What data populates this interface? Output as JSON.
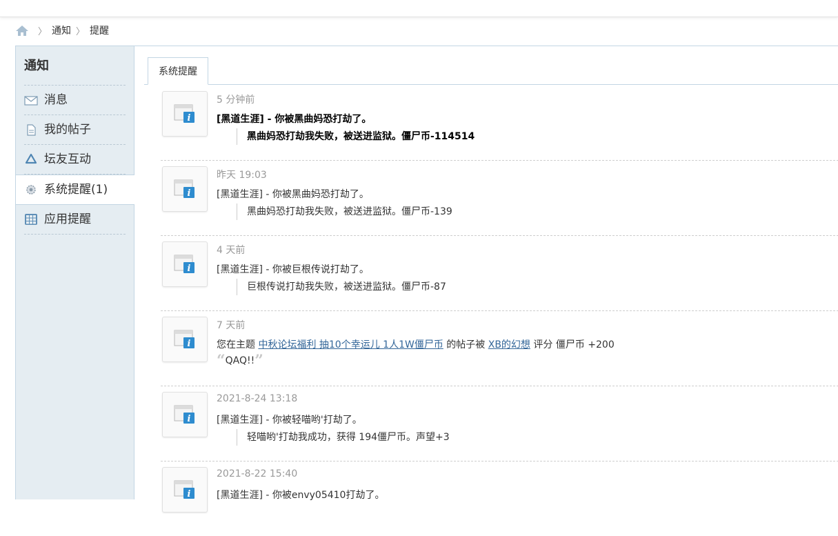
{
  "breadcrumb": {
    "home_icon": "home-icon",
    "items": [
      "通知",
      "提醒"
    ]
  },
  "sidebar": {
    "title": "通知",
    "items": [
      {
        "label": "消息",
        "icon": "mail-icon"
      },
      {
        "label": "我的帖子",
        "icon": "document-icon"
      },
      {
        "label": "坛友互动",
        "icon": "recycle-icon"
      },
      {
        "label": "系统提醒(1)",
        "icon": "gear-icon",
        "active": true
      },
      {
        "label": "应用提醒",
        "icon": "grid-icon"
      }
    ]
  },
  "tabs": [
    {
      "label": "系统提醒",
      "active": true
    }
  ],
  "notices": [
    {
      "time": "5 分钟前",
      "text": "[黑道生涯] - 你被黑曲妈恐打劫了。",
      "quote": "黑曲妈恐打劫我失败，被送进监狱。僵尸币-114514",
      "unread": true
    },
    {
      "time": "昨天 19:03",
      "text": "[黑道生涯] - 你被黑曲妈恐打劫了。",
      "quote": "黑曲妈恐打劫我失败，被送进监狱。僵尸币-139"
    },
    {
      "time": "4 天前",
      "text": "[黑道生涯] - 你被巨根传说打劫了。",
      "quote": "巨根传说打劫我失败，被送进监狱。僵尸币-87"
    },
    {
      "time": "7 天前",
      "prefix": "您在主题",
      "thread_link": "中秋论坛福利 抽10个幸运儿 1人1W僵尸币",
      "middle": "的帖子被",
      "user_link": "XB的幻想",
      "suffix": "评分 僵尸币 +200",
      "rate_quote": "QAQ!!"
    },
    {
      "time": "2021-8-24 13:18",
      "text": "[黑道生涯] - 你被轻喵哟'打劫了。",
      "quote": "轻喵哟'打劫我成功，获得 194僵尸币。声望+3"
    },
    {
      "time": "2021-8-22 15:40",
      "text": "[黑道生涯] - 你被envy05410打劫了。",
      "quote": ""
    }
  ],
  "colors": {
    "sidebar_bg": "#e5edf2",
    "border": "#c2d5e3",
    "link": "#336699",
    "muted": "#999999"
  }
}
